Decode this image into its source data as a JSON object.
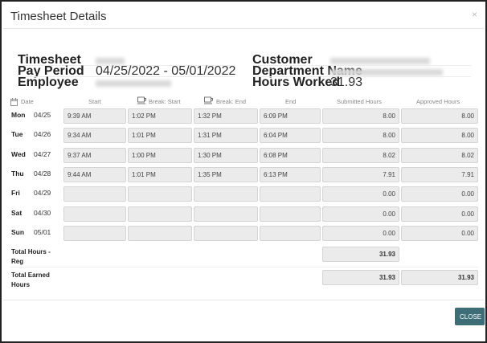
{
  "dialog": {
    "title": "Timesheet Details",
    "close_glyph": "×",
    "close_button": "CLOSE"
  },
  "info": {
    "timesheet_label": "Timesheet",
    "pay_period_label": "Pay Period",
    "pay_period_value": "04/25/2022 - 05/01/2022",
    "employee_label": "Employee",
    "customer_label": "Customer",
    "department_label": "Department Name",
    "hours_worked_label": "Hours Worked",
    "hours_worked_value": "31.93"
  },
  "columns": {
    "date": "Date",
    "start": "Start",
    "break_start": "Break: Start",
    "break_end": "Break: End",
    "end": "End",
    "submitted": "Submitted Hours",
    "approved": "Approved Hours"
  },
  "rows": [
    {
      "day": "Mon",
      "date": "04/25",
      "start": "9:39 AM",
      "break_start": "1:02 PM",
      "break_end": "1:32 PM",
      "end": "6:09 PM",
      "submitted": "8.00",
      "approved": "8.00"
    },
    {
      "day": "Tue",
      "date": "04/26",
      "start": "9:34 AM",
      "break_start": "1:01 PM",
      "break_end": "1:31 PM",
      "end": "6:04 PM",
      "submitted": "8.00",
      "approved": "8.00"
    },
    {
      "day": "Wed",
      "date": "04/27",
      "start": "9:37 AM",
      "break_start": "1:00 PM",
      "break_end": "1:30 PM",
      "end": "6:08 PM",
      "submitted": "8.02",
      "approved": "8.02"
    },
    {
      "day": "Thu",
      "date": "04/28",
      "start": "9:44 AM",
      "break_start": "1:01 PM",
      "break_end": "1:35 PM",
      "end": "6:13 PM",
      "submitted": "7.91",
      "approved": "7.91"
    },
    {
      "day": "Fri",
      "date": "04/29",
      "start": "",
      "break_start": "",
      "break_end": "",
      "end": "",
      "submitted": "0.00",
      "approved": "0.00"
    },
    {
      "day": "Sat",
      "date": "04/30",
      "start": "",
      "break_start": "",
      "break_end": "",
      "end": "",
      "submitted": "0.00",
      "approved": "0.00"
    },
    {
      "day": "Sun",
      "date": "05/01",
      "start": "",
      "break_start": "",
      "break_end": "",
      "end": "",
      "submitted": "0.00",
      "approved": "0.00"
    }
  ],
  "totals": {
    "reg_label_1": "Total Hours -",
    "reg_label_2": "Reg",
    "reg_submitted": "31.93",
    "earned_label_1": "Total Earned",
    "earned_label_2": "Hours",
    "earned_submitted": "31.93",
    "earned_approved": "31.93"
  },
  "icons": [
    "close-icon",
    "calendar-icon",
    "cup-icon"
  ],
  "colors": {
    "close_button": "#3d6e78",
    "cell_bg": "#ebebeb"
  }
}
